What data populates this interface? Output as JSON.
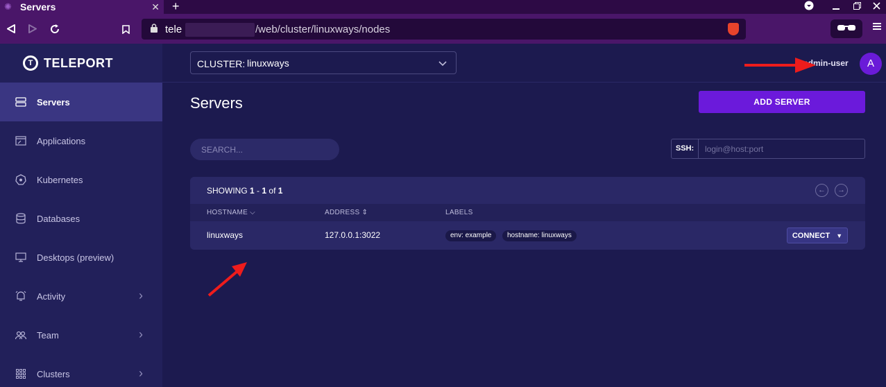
{
  "browser": {
    "tab_title": "Servers",
    "tab_close": "✕",
    "new_tab": "+",
    "url_host": "tele",
    "url_path": "/web/cluster/linuxways/nodes"
  },
  "sidebar": {
    "brand": "TELEPORT",
    "items": [
      {
        "label": "Servers",
        "icon": "server-icon"
      },
      {
        "label": "Applications",
        "icon": "app-window-icon"
      },
      {
        "label": "Kubernetes",
        "icon": "kubernetes-icon"
      },
      {
        "label": "Databases",
        "icon": "database-icon"
      },
      {
        "label": "Desktops (preview)",
        "icon": "desktop-icon"
      },
      {
        "label": "Activity",
        "icon": "bell-icon"
      },
      {
        "label": "Team",
        "icon": "team-icon"
      },
      {
        "label": "Clusters",
        "icon": "grid-icon"
      }
    ]
  },
  "topbar": {
    "cluster_label": "CLUSTER:",
    "cluster_value": "linuxways",
    "username": "admin-user",
    "avatar_initial": "A"
  },
  "main": {
    "title": "Servers",
    "add_button": "ADD SERVER",
    "search_placeholder": "SEARCH...",
    "ssh_label": "SSH:",
    "ssh_placeholder": "login@host:port"
  },
  "table": {
    "showing_prefix": "SHOWING",
    "range_start": "1",
    "range_sep": " - ",
    "range_end": "1",
    "of_word": " of ",
    "total": "1",
    "columns": {
      "hostname": "HOSTNAME",
      "address": "ADDRESS",
      "labels": "LABELS"
    },
    "rows": [
      {
        "hostname": "linuxways",
        "address": "127.0.0.1:3022",
        "labels": [
          "env: example",
          "hostname: linuxways"
        ],
        "action": "CONNECT"
      }
    ]
  },
  "colors": {
    "accent": "#6b1adb",
    "sidebar_bg": "#22205a",
    "main_bg": "#1c1a4f",
    "annotation_arrow": "#ee1c1c"
  }
}
